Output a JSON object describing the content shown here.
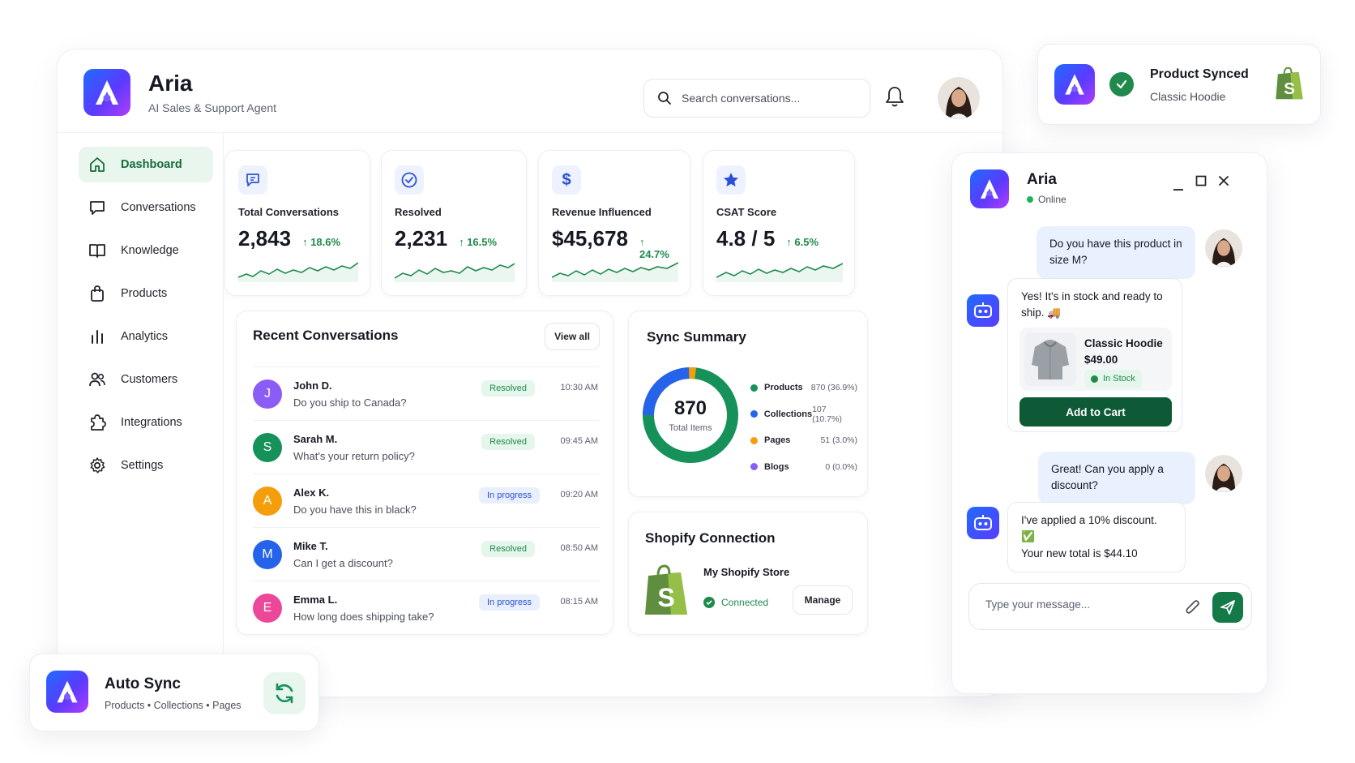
{
  "app": {
    "name": "Aria",
    "subtitle": "AI Sales & Support Agent"
  },
  "search": {
    "placeholder": "Search conversations..."
  },
  "sidebar": {
    "items": [
      {
        "label": "Dashboard",
        "icon": "home-icon",
        "active": true
      },
      {
        "label": "Conversations",
        "icon": "chat-icon"
      },
      {
        "label": "Knowledge",
        "icon": "book-icon"
      },
      {
        "label": "Products",
        "icon": "bag-icon"
      },
      {
        "label": "Analytics",
        "icon": "bar-chart-icon"
      },
      {
        "label": "Customers",
        "icon": "users-icon"
      },
      {
        "label": "Integrations",
        "icon": "puzzle-icon"
      },
      {
        "label": "Settings",
        "icon": "gear-icon"
      }
    ]
  },
  "kpis": [
    {
      "label": "Total Conversations",
      "value": "2,843",
      "delta": "18.6%",
      "icon": "chat-icon"
    },
    {
      "label": "Resolved",
      "value": "2,231",
      "delta": "16.5%",
      "icon": "check-circle-icon"
    },
    {
      "label": "Revenue Influenced",
      "value": "$45,678",
      "delta": "24.7%",
      "icon": "dollar-icon"
    },
    {
      "label": "CSAT Score",
      "value": "4.8 / 5",
      "delta": "6.5%",
      "icon": "star-icon"
    }
  ],
  "recent": {
    "title": "Recent Conversations",
    "view_all": "View all",
    "rows": [
      {
        "initial": "J",
        "name": "John D.",
        "message": "Do you ship to Canada?",
        "status": "Resolved",
        "time": "10:30 AM",
        "color": "#8b5cf6"
      },
      {
        "initial": "S",
        "name": "Sarah M.",
        "message": "What's your return policy?",
        "status": "Resolved",
        "time": "09:45 AM",
        "color": "#16915a"
      },
      {
        "initial": "A",
        "name": "Alex K.",
        "message": "Do you have this in black?",
        "status": "In progress",
        "time": "09:20 AM",
        "color": "#f59e0b"
      },
      {
        "initial": "M",
        "name": "Mike T.",
        "message": "Can I get a discount?",
        "status": "Resolved",
        "time": "08:50 AM",
        "color": "#2563eb"
      },
      {
        "initial": "E",
        "name": "Emma L.",
        "message": "How long does shipping take?",
        "status": "In progress",
        "time": "08:15 AM",
        "color": "#ec4899"
      }
    ]
  },
  "sync": {
    "title": "Sync Summary",
    "total": "870",
    "total_label": "Total Items",
    "items": [
      {
        "name": "Products",
        "value": "870 (36.9%)",
        "color": "#16915a"
      },
      {
        "name": "Collections",
        "value": "107 (10.7%)",
        "color": "#2563eb"
      },
      {
        "name": "Pages",
        "value": "51 (3.0%)",
        "color": "#f59e0b"
      },
      {
        "name": "Blogs",
        "value": "0 (0.0%)",
        "color": "#8b5cf6"
      }
    ]
  },
  "shopify": {
    "title": "Shopify Connection",
    "store": "My Shopify Store",
    "status": "Connected",
    "manage": "Manage"
  },
  "autosync": {
    "title": "Auto Sync",
    "subtitle": "Products • Collections • Pages"
  },
  "product_synced": {
    "title": "Product Synced",
    "subtitle": "Classic Hoodie"
  },
  "chat": {
    "name": "Aria",
    "status": "Online",
    "messages": {
      "user1": "Do you have this product in size M?",
      "bot1": "Yes! It's in stock and ready to ship. 🚚",
      "product_name": "Classic Hoodie",
      "product_price": "$49.00",
      "stock": "In Stock",
      "add_to_cart": "Add to Cart",
      "user2": "Great! Can you apply a discount?",
      "bot2a": "I've applied a 10% discount. ✅",
      "bot2b": "Your new total is $44.10"
    },
    "input_placeholder": "Type your message..."
  },
  "colors": {
    "accent_green": "#137a47",
    "brand_gradient_start": "#1f6bff",
    "brand_gradient_end": "#b13cff"
  }
}
